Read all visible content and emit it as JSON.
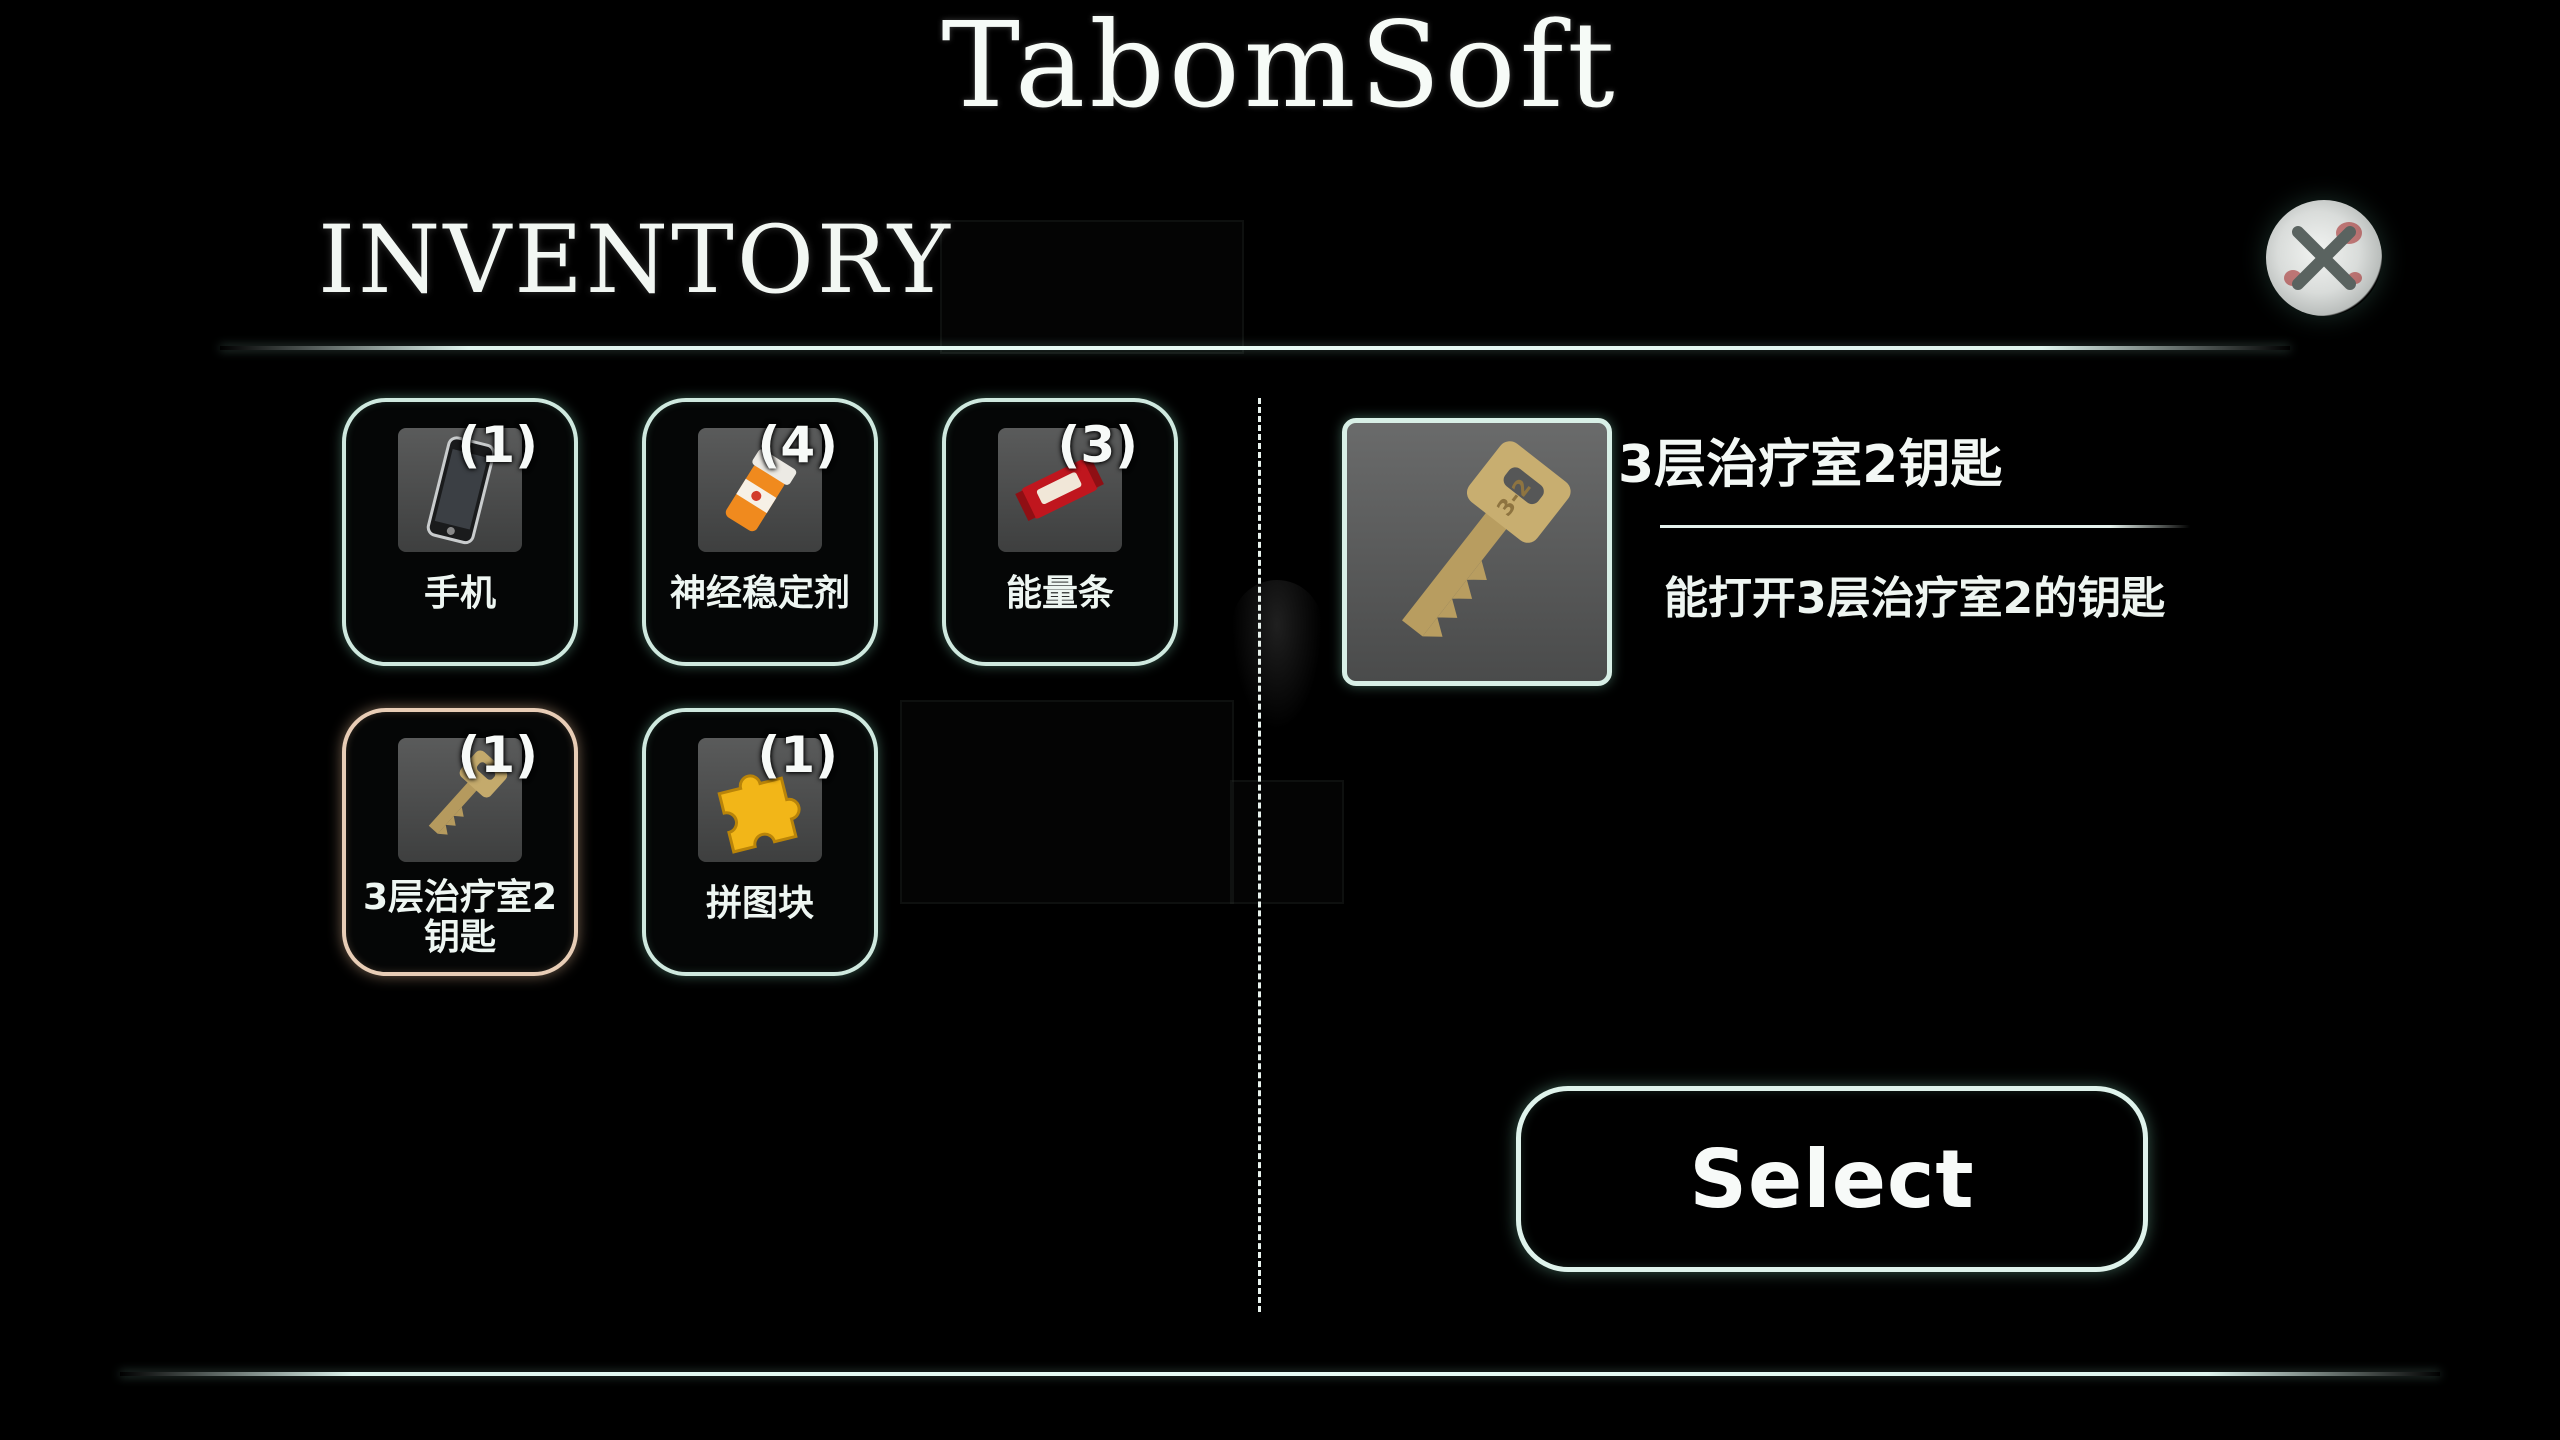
{
  "brand": "TabomSoft",
  "inventory_title": "INVENTORY",
  "close_icon": "close-icon",
  "items": [
    {
      "label": "手机",
      "count": "(1)",
      "icon": "phone-icon"
    },
    {
      "label": "神经稳定剂",
      "count": "(4)",
      "icon": "pill-bottle-icon"
    },
    {
      "label": "能量条",
      "count": "(3)",
      "icon": "energy-bar-icon"
    },
    {
      "label": "3层治疗室2\n钥匙",
      "count": "(1)",
      "icon": "key-icon",
      "selected": true
    },
    {
      "label": "拼图块",
      "count": "(1)",
      "icon": "puzzle-piece-icon"
    }
  ],
  "detail": {
    "name": "3层治疗室2钥匙",
    "description": "能打开3层治疗室2的钥匙",
    "icon": "key-icon"
  },
  "select_label": "Select",
  "colors": {
    "glow": "#cfe9df",
    "selected_border": "#e8cdb6",
    "background": "#000000"
  }
}
